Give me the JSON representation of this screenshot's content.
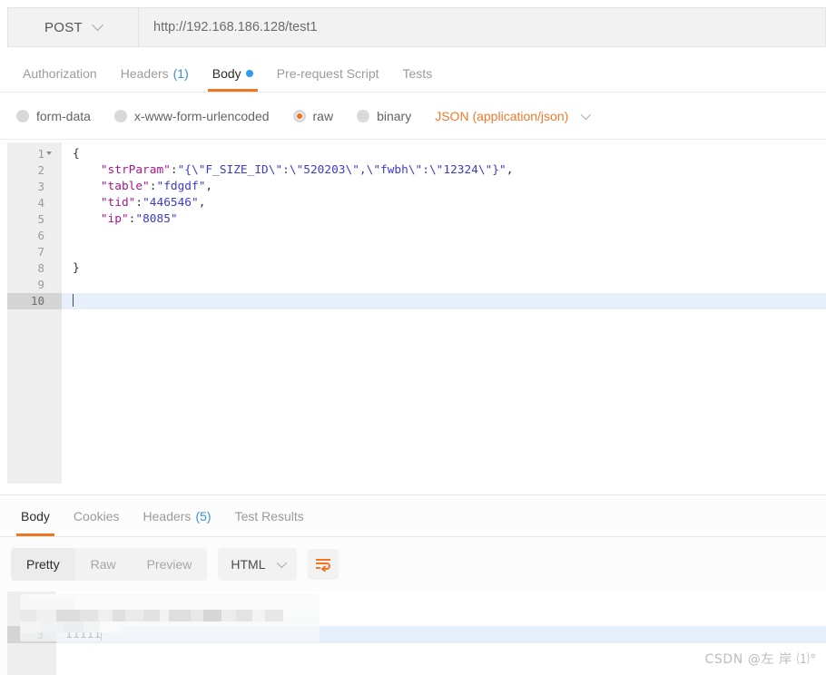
{
  "request": {
    "method": "POST",
    "url": "http://192.168.186.128/test1",
    "tabs": [
      {
        "label": "Authorization",
        "count": "",
        "active": false,
        "dot": false
      },
      {
        "label": "Headers",
        "count": "(1)",
        "active": false,
        "dot": false
      },
      {
        "label": "Body",
        "count": "",
        "active": true,
        "dot": true
      },
      {
        "label": "Pre-request Script",
        "count": "",
        "active": false,
        "dot": false
      },
      {
        "label": "Tests",
        "count": "",
        "active": false,
        "dot": false
      }
    ],
    "body_types": [
      {
        "label": "form-data",
        "selected": false
      },
      {
        "label": "x-www-form-urlencoded",
        "selected": false
      },
      {
        "label": "raw",
        "selected": true
      },
      {
        "label": "binary",
        "selected": false
      }
    ],
    "content_type": "JSON (application/json)",
    "editor": {
      "lines": [
        {
          "n": "1",
          "fold": true,
          "segments": [
            {
              "t": "{",
              "c": "p"
            }
          ],
          "active": false
        },
        {
          "n": "2",
          "fold": false,
          "segments": [
            {
              "t": "    ",
              "c": "p"
            },
            {
              "t": "\"strParam\"",
              "c": "k"
            },
            {
              "t": ":",
              "c": "p"
            },
            {
              "t": "\"{\\\"F_SIZE_ID\\\":\\\"520203\\\",\\\"fwbh\\\":\\\"12324\\\"}\"",
              "c": "s"
            },
            {
              "t": ",",
              "c": "p"
            }
          ],
          "active": false
        },
        {
          "n": "3",
          "fold": false,
          "segments": [
            {
              "t": "    ",
              "c": "p"
            },
            {
              "t": "\"table\"",
              "c": "k"
            },
            {
              "t": ":",
              "c": "p"
            },
            {
              "t": "\"fdgdf\"",
              "c": "s"
            },
            {
              "t": ",",
              "c": "p"
            }
          ],
          "active": false
        },
        {
          "n": "4",
          "fold": false,
          "segments": [
            {
              "t": "    ",
              "c": "p"
            },
            {
              "t": "\"tid\"",
              "c": "k"
            },
            {
              "t": ":",
              "c": "p"
            },
            {
              "t": "\"446546\"",
              "c": "s"
            },
            {
              "t": ",",
              "c": "p"
            }
          ],
          "active": false
        },
        {
          "n": "5",
          "fold": false,
          "segments": [
            {
              "t": "    ",
              "c": "p"
            },
            {
              "t": "\"ip\"",
              "c": "k"
            },
            {
              "t": ":",
              "c": "p"
            },
            {
              "t": "\"8085\"",
              "c": "s"
            }
          ],
          "active": false
        },
        {
          "n": "6",
          "fold": false,
          "segments": [],
          "active": false
        },
        {
          "n": "7",
          "fold": false,
          "segments": [],
          "active": false
        },
        {
          "n": "8",
          "fold": false,
          "segments": [
            {
              "t": "}",
              "c": "p"
            }
          ],
          "active": false
        },
        {
          "n": "9",
          "fold": false,
          "segments": [],
          "active": false
        },
        {
          "n": "10",
          "fold": false,
          "segments": [],
          "active": true,
          "caret": true
        }
      ]
    }
  },
  "response": {
    "tabs": [
      {
        "label": "Body",
        "count": "",
        "active": true
      },
      {
        "label": "Cookies",
        "count": "",
        "active": false
      },
      {
        "label": "Headers",
        "count": "(5)",
        "active": false
      },
      {
        "label": "Test Results",
        "count": "",
        "active": false
      }
    ],
    "view_modes": [
      {
        "label": "Pretty",
        "active": true
      },
      {
        "label": "Raw",
        "active": false
      },
      {
        "label": "Preview",
        "active": false
      }
    ],
    "format": "HTML",
    "wrap_icon": "word-wrap-icon",
    "body_lines": [
      {
        "n": "i",
        "text": "",
        "active": false,
        "info": true,
        "redacted": true
      },
      {
        "n": "2",
        "text": "",
        "active": false,
        "info": false,
        "redacted": true
      },
      {
        "n": "3",
        "text": "11111",
        "active": true,
        "info": false,
        "redacted": false,
        "caret": true
      }
    ]
  },
  "watermark": "CSDN @左 岸 ⑴°",
  "colors": {
    "accent": "#ef7622",
    "content_type": "#f0792c",
    "count_blue": "#3a8fd8",
    "dot_blue": "#2c9bf0",
    "active_line": "#e7f0fa"
  }
}
